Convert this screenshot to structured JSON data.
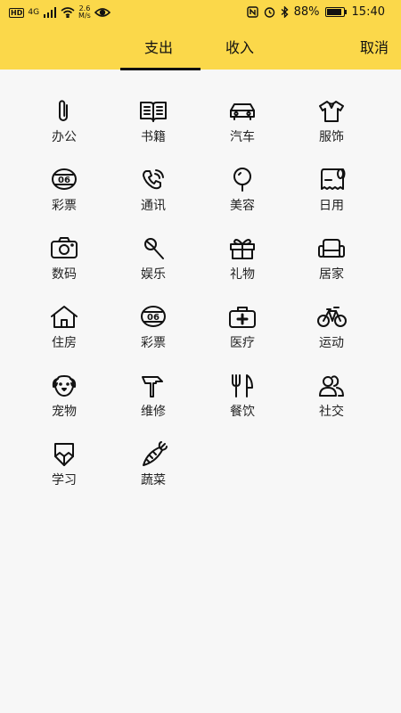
{
  "status": {
    "hd": "HD",
    "network": "4G",
    "speed_value": "2.6",
    "speed_unit": "M/s",
    "battery": "88%",
    "battery_level": 0.88,
    "time": "15:40"
  },
  "header": {
    "tab_expense": "支出",
    "tab_income": "收入",
    "cancel": "取消",
    "accent_color": "#fbd84a"
  },
  "categories": [
    {
      "label": "办公",
      "icon": "paperclip-icon"
    },
    {
      "label": "书籍",
      "icon": "book-icon"
    },
    {
      "label": "汽车",
      "icon": "car-icon"
    },
    {
      "label": "服饰",
      "icon": "shirt-icon"
    },
    {
      "label": "彩票",
      "icon": "lottery-ball-icon",
      "icon_text": "06"
    },
    {
      "label": "通讯",
      "icon": "phone-icon"
    },
    {
      "label": "美容",
      "icon": "mirror-icon"
    },
    {
      "label": "日用",
      "icon": "tissue-roll-icon"
    },
    {
      "label": "数码",
      "icon": "camera-icon"
    },
    {
      "label": "娱乐",
      "icon": "microphone-icon"
    },
    {
      "label": "礼物",
      "icon": "gift-icon"
    },
    {
      "label": "居家",
      "icon": "sofa-icon"
    },
    {
      "label": "住房",
      "icon": "house-icon"
    },
    {
      "label": "彩票",
      "icon": "lottery-ball-icon",
      "icon_text": "06"
    },
    {
      "label": "医疗",
      "icon": "medical-kit-icon"
    },
    {
      "label": "运动",
      "icon": "bicycle-icon"
    },
    {
      "label": "宠物",
      "icon": "dog-icon"
    },
    {
      "label": "维修",
      "icon": "hammer-icon"
    },
    {
      "label": "餐饮",
      "icon": "fork-knife-icon"
    },
    {
      "label": "社交",
      "icon": "people-icon"
    },
    {
      "label": "学习",
      "icon": "pencil-icon"
    },
    {
      "label": "蔬菜",
      "icon": "carrot-icon"
    }
  ]
}
